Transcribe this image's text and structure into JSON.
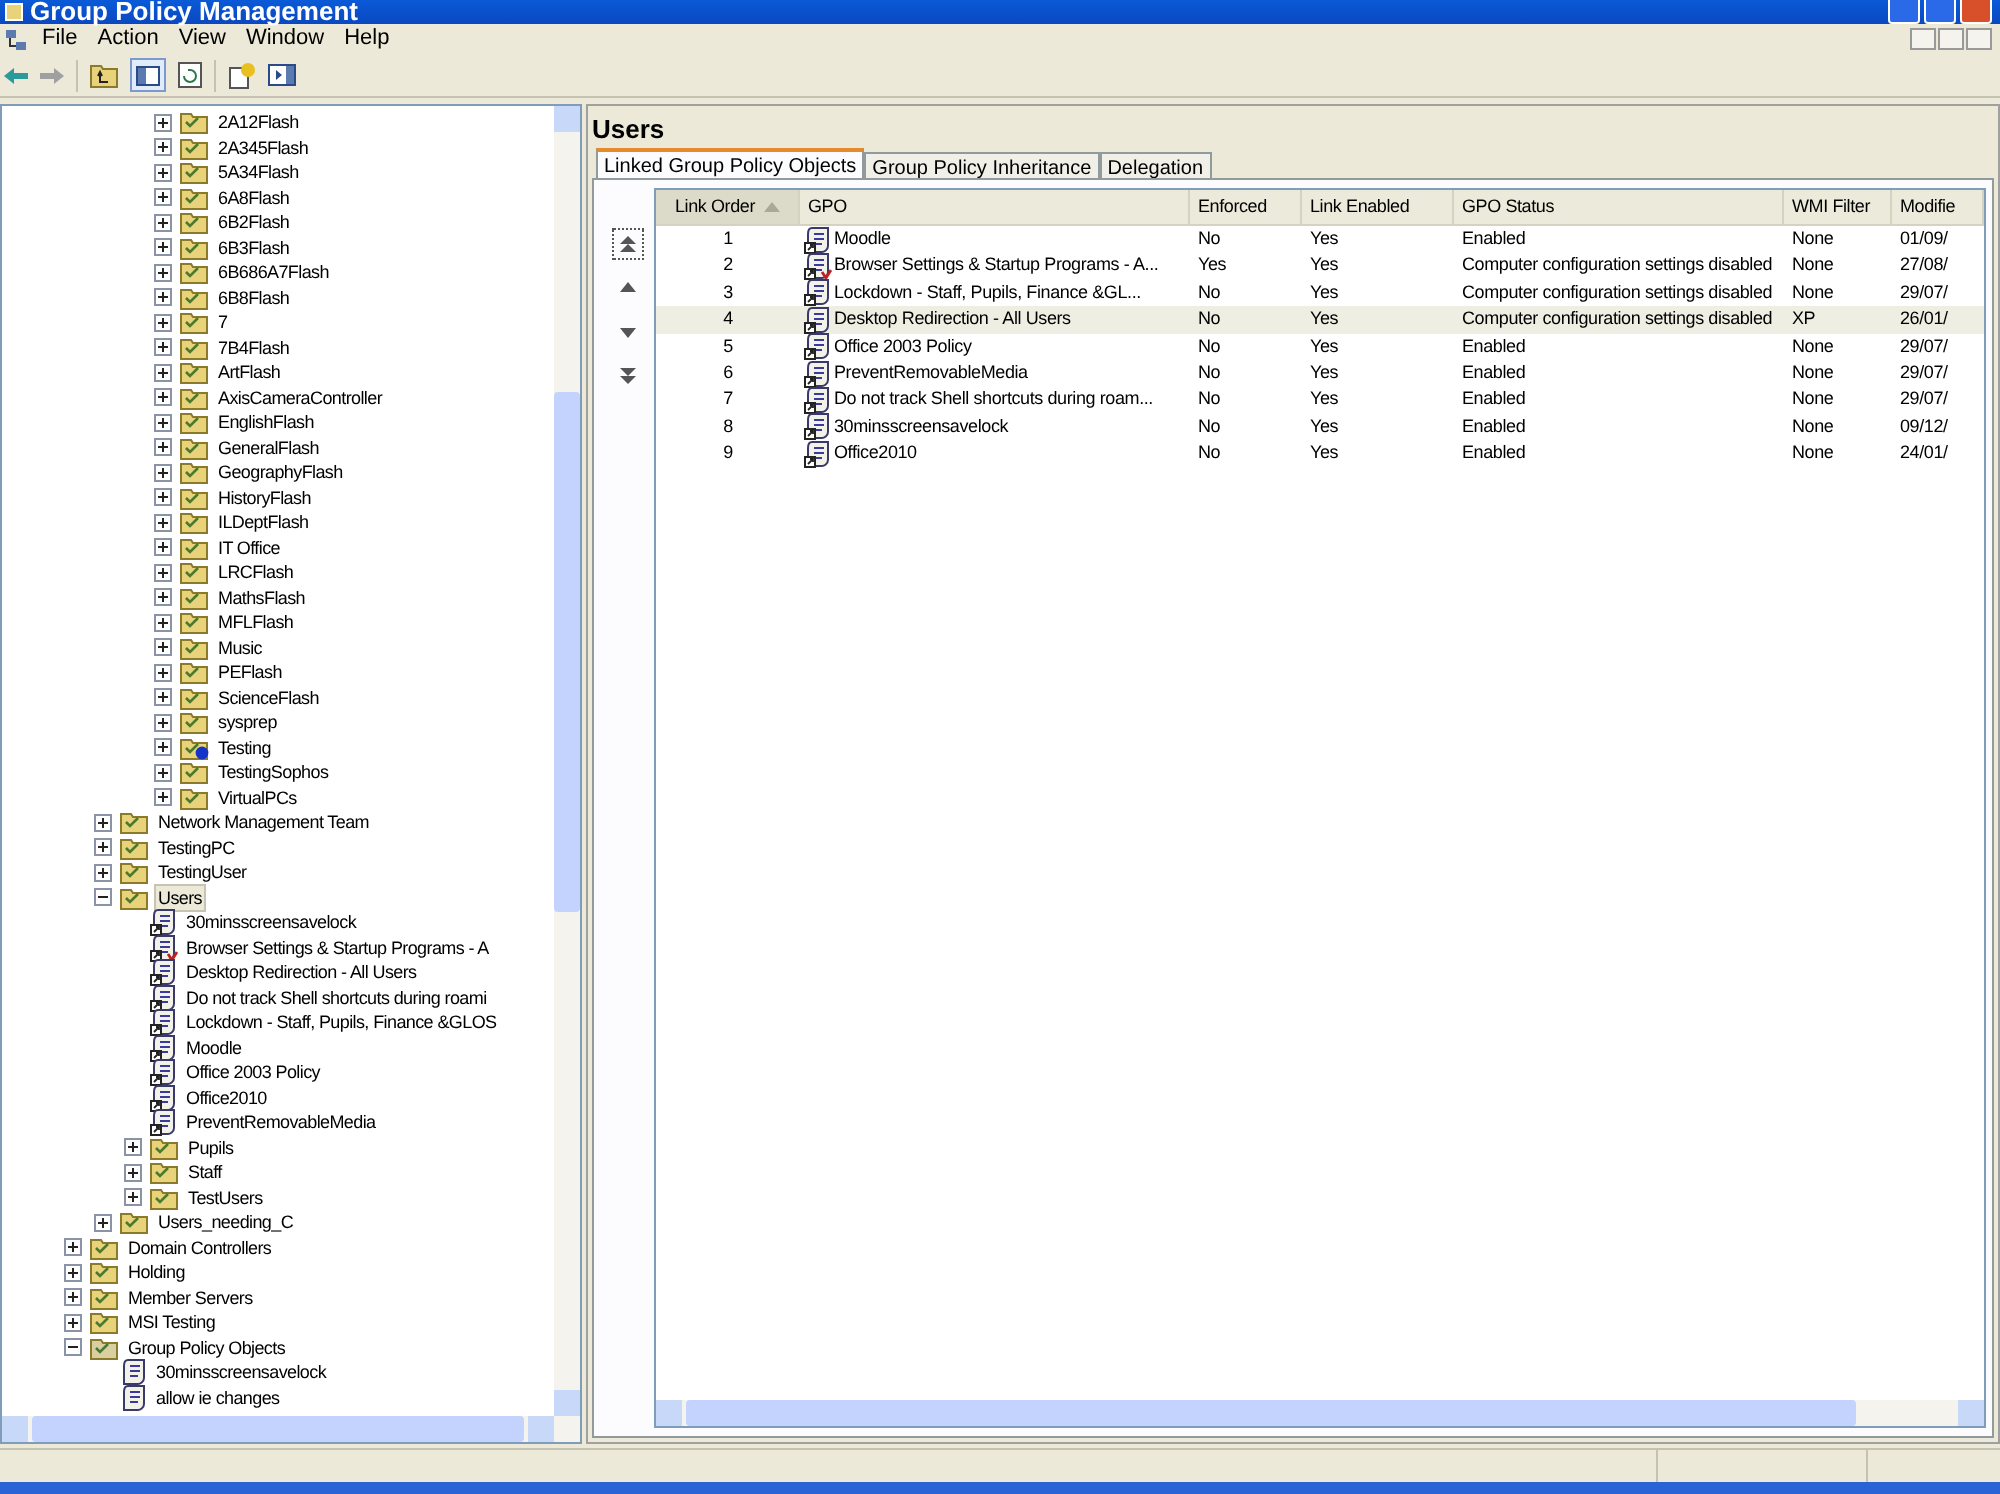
{
  "window": {
    "title": "Group Policy Management"
  },
  "menu": [
    "File",
    "Action",
    "View",
    "Window",
    "Help"
  ],
  "tree": {
    "items": [
      {
        "children": [
          {
            "children": [
              {
                "children": [
                  {
                    "label": "2A12Flash",
                    "kind": "folder",
                    "expanded": false,
                    "selected": false
                  },
                  {
                    "label": "2A345Flash",
                    "kind": "folder",
                    "expanded": false,
                    "selected": false
                  },
                  {
                    "label": "5A34Flash",
                    "kind": "folder",
                    "expanded": false,
                    "selected": false
                  },
                  {
                    "label": "6A8Flash",
                    "kind": "folder",
                    "expanded": false,
                    "selected": false
                  },
                  {
                    "label": "6B2Flash",
                    "kind": "folder",
                    "expanded": false,
                    "selected": false
                  },
                  {
                    "label": "6B3Flash",
                    "kind": "folder",
                    "expanded": false,
                    "selected": false
                  },
                  {
                    "label": "6B686A7Flash",
                    "kind": "folder",
                    "expanded": false,
                    "selected": false
                  },
                  {
                    "label": "6B8Flash",
                    "kind": "folder",
                    "expanded": false,
                    "selected": false
                  },
                  {
                    "label": "7",
                    "kind": "folder",
                    "expanded": false,
                    "selected": false
                  },
                  {
                    "label": "7B4Flash",
                    "kind": "folder",
                    "expanded": false,
                    "selected": false
                  },
                  {
                    "label": "ArtFlash",
                    "kind": "folder",
                    "expanded": false,
                    "selected": false
                  },
                  {
                    "label": "AxisCameraController",
                    "kind": "folder",
                    "expanded": false,
                    "selected": false
                  },
                  {
                    "label": "EnglishFlash",
                    "kind": "folder",
                    "expanded": false,
                    "selected": false
                  },
                  {
                    "label": "GeneralFlash",
                    "kind": "folder",
                    "expanded": false,
                    "selected": false
                  },
                  {
                    "label": "GeographyFlash",
                    "kind": "folder",
                    "expanded": false,
                    "selected": false
                  },
                  {
                    "label": "HistoryFlash",
                    "kind": "folder",
                    "expanded": false,
                    "selected": false
                  },
                  {
                    "label": "ILDeptFlash",
                    "kind": "folder",
                    "expanded": false,
                    "selected": false
                  },
                  {
                    "label": "IT Office",
                    "kind": "folder",
                    "expanded": false,
                    "selected": false
                  },
                  {
                    "label": "LRCFlash",
                    "kind": "folder",
                    "expanded": false,
                    "selected": false
                  },
                  {
                    "label": "MathsFlash",
                    "kind": "folder",
                    "expanded": false,
                    "selected": false
                  },
                  {
                    "label": "MFLFlash",
                    "kind": "folder",
                    "expanded": false,
                    "selected": false
                  },
                  {
                    "label": "Music",
                    "kind": "folder",
                    "expanded": false,
                    "selected": false
                  },
                  {
                    "label": "PEFlash",
                    "kind": "folder",
                    "expanded": false,
                    "selected": false
                  },
                  {
                    "label": "ScienceFlash",
                    "kind": "folder",
                    "expanded": false,
                    "selected": false
                  },
                  {
                    "label": "sysprep",
                    "kind": "folder",
                    "expanded": false,
                    "selected": false
                  },
                  {
                    "label": "Testing",
                    "kind": "folder-info",
                    "expanded": false,
                    "selected": false
                  },
                  {
                    "label": "TestingSophos",
                    "kind": "folder",
                    "expanded": false,
                    "selected": false
                  },
                  {
                    "label": "VirtualPCs",
                    "kind": "folder",
                    "expanded": false,
                    "selected": false
                  }
                ]
              }
            ]
          },
          {
            "label": "Network Management Team",
            "kind": "folder",
            "expanded": false,
            "selected": false
          },
          {
            "label": "TestingPC",
            "kind": "folder",
            "expanded": false,
            "selected": false
          },
          {
            "label": "TestingUser",
            "kind": "folder",
            "expanded": false,
            "selected": false
          },
          {
            "label": "Users",
            "kind": "folder",
            "expanded": true,
            "selected": true,
            "children": [
              {
                "label": "30minsscreensavelock",
                "kind": "link",
                "selected": false
              },
              {
                "label": "Browser Settings & Startup Programs - A",
                "kind": "enforced-link",
                "selected": false
              },
              {
                "label": "Desktop Redirection - All Users",
                "kind": "link",
                "selected": false
              },
              {
                "label": "Do not track Shell shortcuts during roami",
                "kind": "link",
                "selected": false
              },
              {
                "label": "Lockdown - Staff, Pupils, Finance &GLOS",
                "kind": "link",
                "selected": false
              },
              {
                "label": "Moodle",
                "kind": "link",
                "selected": false
              },
              {
                "label": "Office 2003 Policy",
                "kind": "link",
                "selected": false
              },
              {
                "label": "Office2010",
                "kind": "link",
                "selected": false
              },
              {
                "label": "PreventRemovableMedia",
                "kind": "link",
                "selected": false
              },
              {
                "label": "Pupils",
                "kind": "folder",
                "expanded": false,
                "selected": false
              },
              {
                "label": "Staff",
                "kind": "folder",
                "expanded": false,
                "selected": false
              },
              {
                "label": "TestUsers",
                "kind": "folder",
                "expanded": false,
                "selected": false
              }
            ]
          },
          {
            "label": "Users_needing_C",
            "kind": "folder",
            "expanded": false,
            "selected": false
          }
        ]
      },
      {
        "label": "Domain Controllers",
        "kind": "folder",
        "expanded": false,
        "selected": false
      },
      {
        "label": "Holding",
        "kind": "folder",
        "expanded": false,
        "selected": false
      },
      {
        "label": "Member Servers",
        "kind": "folder",
        "expanded": false,
        "selected": false
      },
      {
        "label": "MSI Testing",
        "kind": "folder",
        "expanded": false,
        "selected": false
      },
      {
        "label": "Group Policy Objects",
        "kind": "gpo-container",
        "expanded": true,
        "selected": false,
        "children": [
          {
            "label": "30minsscreensavelock",
            "kind": "gpo",
            "selected": false
          },
          {
            "label": "allow ie changes",
            "kind": "gpo",
            "selected": false
          }
        ]
      }
    ]
  },
  "details": {
    "title": "Users",
    "tabs": [
      {
        "label": "Linked Group Policy Objects",
        "selected": true
      },
      {
        "label": "Group Policy Inheritance",
        "selected": false
      },
      {
        "label": "Delegation",
        "selected": false
      }
    ],
    "columns": [
      {
        "label": "Link Order",
        "sorted": true
      },
      {
        "label": "GPO",
        "sorted": false
      },
      {
        "label": "Enforced",
        "sorted": false
      },
      {
        "label": "Link Enabled",
        "sorted": false
      },
      {
        "label": "GPO Status",
        "sorted": false
      },
      {
        "label": "WMI Filter",
        "sorted": false
      },
      {
        "label": "Modifie",
        "sorted": false
      }
    ],
    "rows": [
      {
        "link_order": "1",
        "gpo": "Moodle",
        "kind": "link",
        "enforced": "No",
        "link_enabled": "Yes",
        "gpo_status": "Enabled",
        "wmi_filter": "None",
        "modified": "01/09/",
        "selected": false
      },
      {
        "link_order": "2",
        "gpo": "Browser Settings & Startup Programs - A...",
        "kind": "enforced-link",
        "enforced": "Yes",
        "link_enabled": "Yes",
        "gpo_status": "Computer configuration settings disabled",
        "wmi_filter": "None",
        "modified": "27/08/",
        "selected": false
      },
      {
        "link_order": "3",
        "gpo": "Lockdown - Staff, Pupils, Finance &GL...",
        "kind": "link",
        "enforced": "No",
        "link_enabled": "Yes",
        "gpo_status": "Computer configuration settings disabled",
        "wmi_filter": "None",
        "modified": "29/07/",
        "selected": false
      },
      {
        "link_order": "4",
        "gpo": "Desktop Redirection - All Users",
        "kind": "link",
        "enforced": "No",
        "link_enabled": "Yes",
        "gpo_status": "Computer configuration settings disabled",
        "wmi_filter": "XP",
        "modified": "26/01/",
        "selected": true
      },
      {
        "link_order": "5",
        "gpo": "Office 2003 Policy",
        "kind": "link",
        "enforced": "No",
        "link_enabled": "Yes",
        "gpo_status": "Enabled",
        "wmi_filter": "None",
        "modified": "29/07/",
        "selected": false
      },
      {
        "link_order": "6",
        "gpo": "PreventRemovableMedia",
        "kind": "link",
        "enforced": "No",
        "link_enabled": "Yes",
        "gpo_status": "Enabled",
        "wmi_filter": "None",
        "modified": "29/07/",
        "selected": false
      },
      {
        "link_order": "7",
        "gpo": "Do not track Shell shortcuts during roam...",
        "kind": "link",
        "enforced": "No",
        "link_enabled": "Yes",
        "gpo_status": "Enabled",
        "wmi_filter": "None",
        "modified": "29/07/",
        "selected": false
      },
      {
        "link_order": "8",
        "gpo": "30minsscreensavelock",
        "kind": "link",
        "enforced": "No",
        "link_enabled": "Yes",
        "gpo_status": "Enabled",
        "wmi_filter": "None",
        "modified": "09/12/",
        "selected": false
      },
      {
        "link_order": "9",
        "gpo": "Office2010",
        "kind": "link",
        "enforced": "No",
        "link_enabled": "Yes",
        "gpo_status": "Enabled",
        "wmi_filter": "None",
        "modified": "24/01/",
        "selected": false
      }
    ]
  }
}
